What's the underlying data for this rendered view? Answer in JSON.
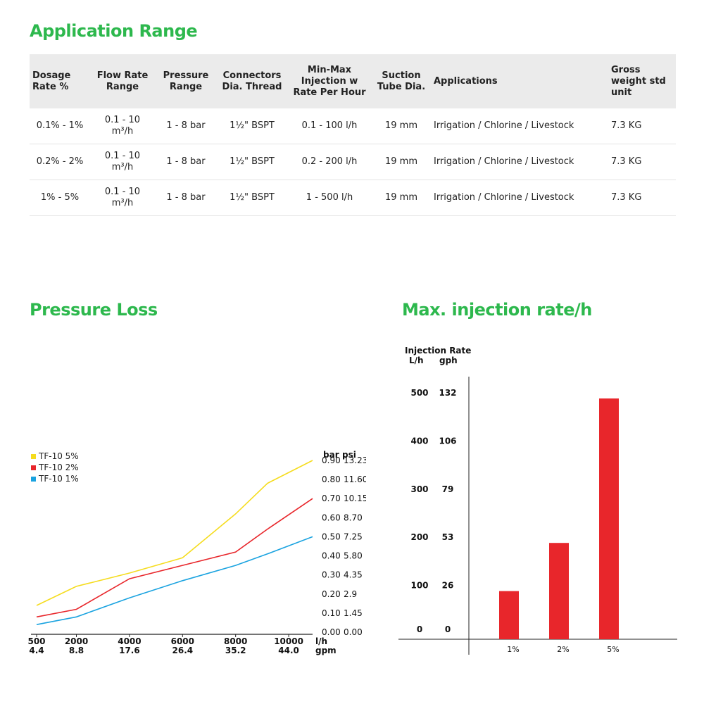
{
  "application_range": {
    "title": "Application Range",
    "headers": [
      "Dosage Rate %",
      "Flow Rate Range",
      "Pressure Range",
      "Connectors Dia. Thread",
      "Min-Max Injection w Rate Per Hour",
      "Suction Tube Dia.",
      "Applications",
      "Gross weight std unit"
    ],
    "rows": [
      {
        "dosage": "0.1% - 1%",
        "flow": "0.1 - 10 m³/h",
        "pressure": "1 - 8 bar",
        "connectors": "1½\" BSPT",
        "injection": "0.1 - 100 l/h",
        "suction": "19 mm",
        "applications": "Irrigation / Chlorine / Livestock",
        "weight": "7.3 KG"
      },
      {
        "dosage": "0.2% - 2%",
        "flow": "0.1 - 10 m³/h",
        "pressure": "1 - 8 bar",
        "connectors": "1½\" BSPT",
        "injection": "0.2 - 200 l/h",
        "suction": "19 mm",
        "applications": "Irrigation / Chlorine / Livestock",
        "weight": "7.3 KG"
      },
      {
        "dosage": "1% - 5%",
        "flow": "0.1 - 10 m³/h",
        "pressure": "1 - 8 bar",
        "connectors": "1½\" BSPT",
        "injection": "1 - 500 l/h",
        "suction": "19 mm",
        "applications": "Irrigation / Chlorine / Livestock",
        "weight": "7.3 KG"
      }
    ]
  },
  "colors": {
    "accent_green": "#2db84d",
    "bar_red": "#e8262b",
    "line_yellow": "#f5dc1e",
    "line_red": "#e8262b",
    "line_blue": "#1aa3e0"
  },
  "chart_data": [
    {
      "type": "line",
      "title": "Pressure Loss",
      "xlabel": "l/h",
      "xlabel2": "gpm",
      "ylabel": "bar",
      "ylabel2": "psi",
      "x": [
        500,
        2000,
        4000,
        6000,
        8000,
        9200,
        10900
      ],
      "x_ticks": [
        500,
        2000,
        4000,
        6000,
        8000,
        10000
      ],
      "x_tick_labels": [
        "500",
        "2000",
        "4000",
        "6000",
        "8000",
        "10000"
      ],
      "x_tick_labels2": [
        "4.4",
        "8.8",
        "17.6",
        "26.4",
        "35.2",
        "44.0"
      ],
      "y_ticks": [
        0.0,
        0.1,
        0.2,
        0.3,
        0.4,
        0.5,
        0.6,
        0.7,
        0.8,
        0.9
      ],
      "y_tick_labels": [
        "0.00",
        "0.10",
        "0.20",
        "0.30",
        "0.40",
        "0.50",
        "0.60",
        "0.70",
        "0.80",
        "0.90"
      ],
      "y_tick_labels2": [
        "0.00",
        "1.45",
        "2.9",
        "4.35",
        "5.80",
        "7.25",
        "8.70",
        "10.15",
        "11.60",
        "13.23"
      ],
      "xlim": [
        500,
        10900
      ],
      "ylim": [
        0,
        0.9
      ],
      "legend": "top-left",
      "series": [
        {
          "name": "TF-10 5%",
          "color": "#f5dc1e",
          "values": [
            0.14,
            0.24,
            0.31,
            0.39,
            0.62,
            0.78,
            0.9
          ]
        },
        {
          "name": "TF-10 2%",
          "color": "#e8262b",
          "values": [
            0.08,
            0.12,
            0.28,
            0.35,
            0.42,
            0.54,
            0.7
          ]
        },
        {
          "name": "TF-10 1%",
          "color": "#1aa3e0",
          "values": [
            0.04,
            0.08,
            0.18,
            0.27,
            0.35,
            0.41,
            0.5
          ]
        }
      ]
    },
    {
      "type": "bar",
      "title": "Max. injection rate/h",
      "ylabel": "Injection Rate",
      "ylabel_unit1": "L/h",
      "ylabel_unit2": "gph",
      "categories": [
        "1%",
        "2%",
        "5%"
      ],
      "values": [
        100,
        200,
        500
      ],
      "y_ticks": [
        0,
        100,
        200,
        300,
        400,
        500
      ],
      "y_tick_labels": [
        "0",
        "100",
        "200",
        "300",
        "400",
        "500"
      ],
      "y_tick_labels2": [
        "0",
        "26",
        "53",
        "79",
        "106",
        "132"
      ],
      "ylim": [
        0,
        500
      ]
    }
  ]
}
